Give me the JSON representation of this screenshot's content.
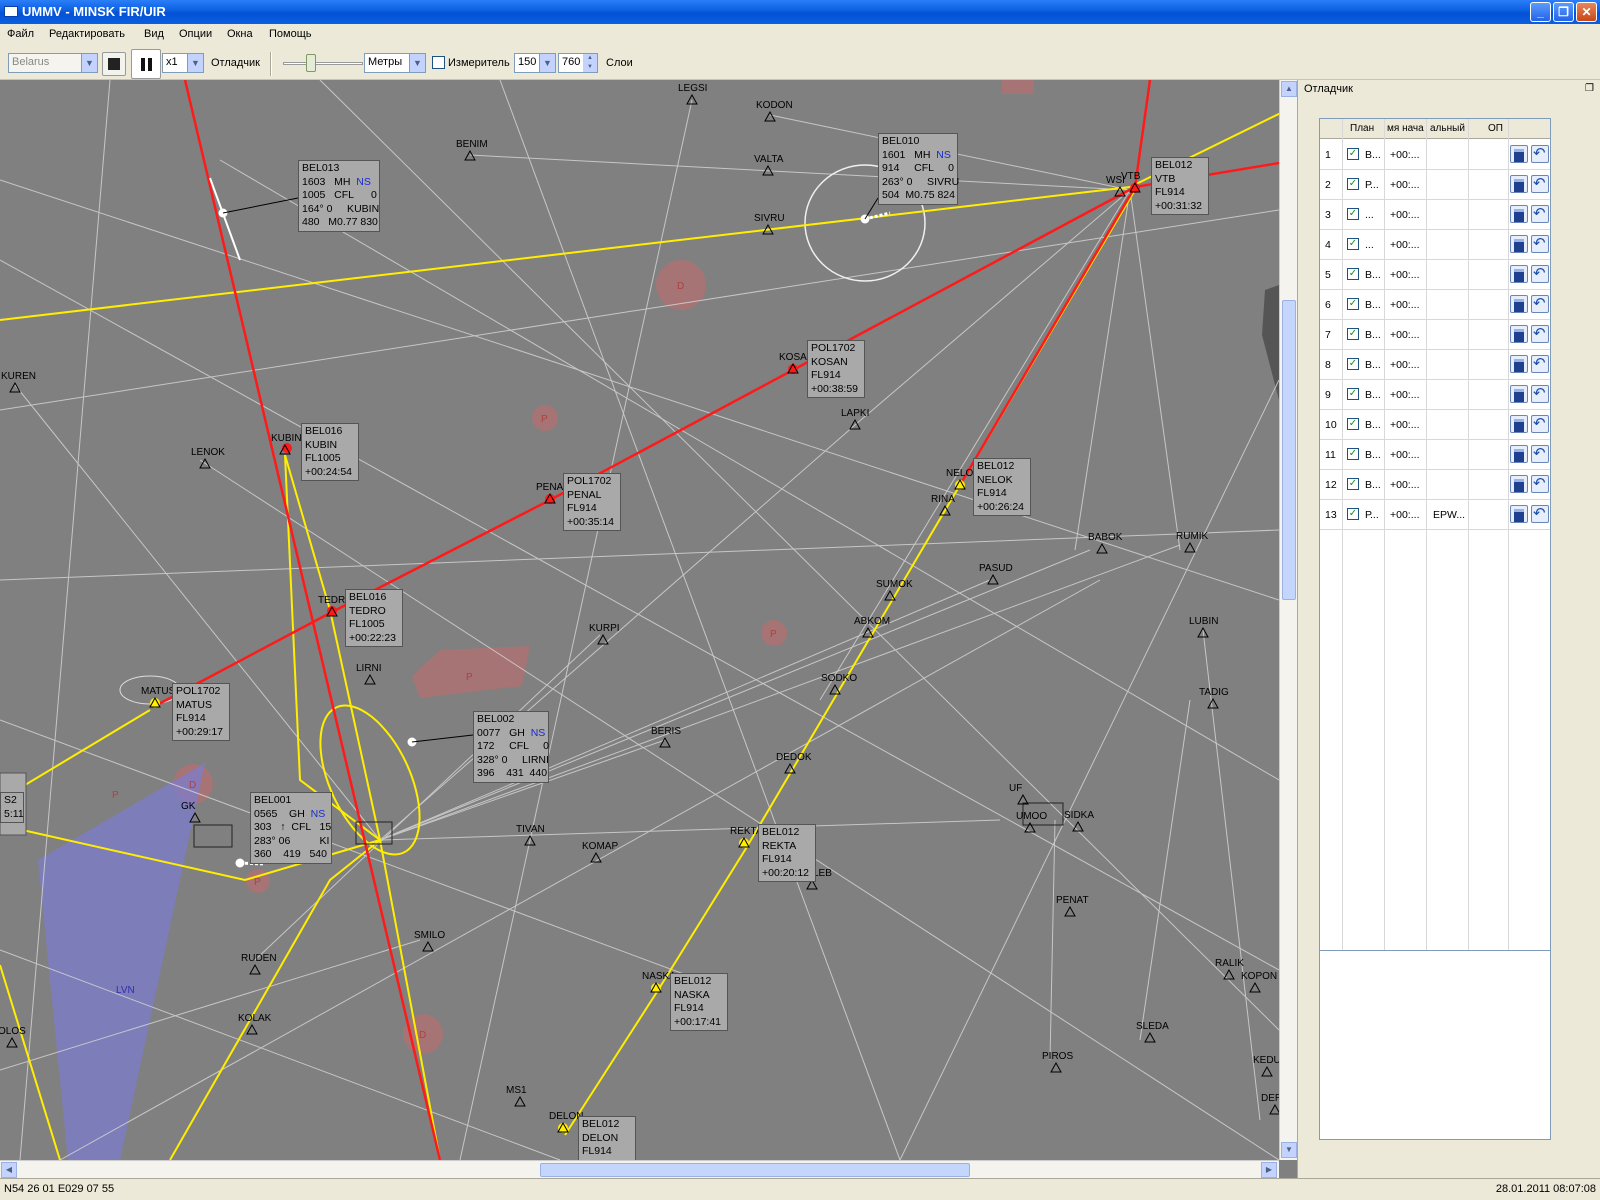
{
  "window": {
    "title": "UMMV - MINSK FIR/UIR",
    "minimize": "_",
    "maximize": "❐",
    "close": "✕"
  },
  "menu": [
    "Файл",
    "Редактировать",
    "Вид",
    "Опции",
    "Окна",
    "Помощь"
  ],
  "toolbar": {
    "region": "Belarus",
    "speed": "x1",
    "debugger_label": "Отладчик",
    "units": "Метры",
    "measure_label": "Измеритель",
    "measure_value": "150",
    "level_value": "760",
    "layers_label": "Слои"
  },
  "map": {
    "waypoints": [
      {
        "name": "LEGSI"
      },
      {
        "name": "KODON"
      },
      {
        "name": "BENIM"
      },
      {
        "name": "VALTA"
      },
      {
        "name": "SIVRU"
      },
      {
        "name": "KUREN"
      },
      {
        "name": "LENOK"
      },
      {
        "name": "KUBIN"
      },
      {
        "name": "KOSAN"
      },
      {
        "name": "LAPKI"
      },
      {
        "name": "PENAL"
      },
      {
        "name": "NELOK"
      },
      {
        "name": "RINA"
      },
      {
        "name": "BABOK"
      },
      {
        "name": "RUMIK"
      },
      {
        "name": "PASUD"
      },
      {
        "name": "SUMOK"
      },
      {
        "name": "ABKOM"
      },
      {
        "name": "KURPI"
      },
      {
        "name": "TEDRO"
      },
      {
        "name": "LIRNI"
      },
      {
        "name": "MATUS"
      },
      {
        "name": "LUBIN"
      },
      {
        "name": "TADIG"
      },
      {
        "name": "SODKO"
      },
      {
        "name": "BERIS"
      },
      {
        "name": "DEDOK"
      },
      {
        "name": "UF"
      },
      {
        "name": "UMOO"
      },
      {
        "name": "SIDKA"
      },
      {
        "name": "TIVAN"
      },
      {
        "name": "KOMAP"
      },
      {
        "name": "REKTA"
      },
      {
        "name": "DOLEB"
      },
      {
        "name": "PENAT"
      },
      {
        "name": "SMILO"
      },
      {
        "name": "RUDEN"
      },
      {
        "name": "NASKA"
      },
      {
        "name": "RALIK"
      },
      {
        "name": "KOPON"
      },
      {
        "name": "KOLAK"
      },
      {
        "name": "SLEDA"
      },
      {
        "name": "PIROS"
      },
      {
        "name": "KEDUG"
      },
      {
        "name": "DERAD"
      },
      {
        "name": "MS1"
      },
      {
        "name": "DELON"
      },
      {
        "name": "OLOS"
      },
      {
        "name": "GK"
      },
      {
        "name": "VTB"
      },
      {
        "name": "WSI"
      },
      {
        "name": "RAT"
      }
    ],
    "zone_labels": [
      "D",
      "P",
      "P",
      "D",
      "D",
      "P",
      "P",
      "P",
      "LVN"
    ],
    "datablocks": [
      {
        "id": "bel013",
        "lines": [
          "BEL013",
          "1603   MH",
          "1005   CFL      0",
          "164° 0     KUBIN",
          "480   M0.77 830"
        ],
        "badge": "NS"
      },
      {
        "id": "bel010",
        "lines": [
          "BEL010",
          "1601   MH",
          "914     CFL     0",
          "263° 0     SIVRU",
          "504  M0.75 824"
        ],
        "badge": "NS"
      },
      {
        "id": "bel012a",
        "lines": [
          "BEL012",
          "VTB",
          "FL914",
          "+00:31:32"
        ]
      },
      {
        "id": "pol1702a",
        "lines": [
          "POL1702",
          "KOSAN",
          "FL914",
          "+00:38:59"
        ]
      },
      {
        "id": "bel016a",
        "lines": [
          "BEL016",
          "KUBIN",
          "FL1005",
          "+00:24:54"
        ]
      },
      {
        "id": "pol1702b",
        "lines": [
          "POL1702",
          "PENAL",
          "FL914",
          "+00:35:14"
        ]
      },
      {
        "id": "bel012b",
        "lines": [
          "BEL012",
          "NELOK",
          "FL914",
          "+00:26:24"
        ]
      },
      {
        "id": "bel016b",
        "lines": [
          "BEL016",
          "TEDRO",
          "FL1005",
          "+00:22:23"
        ]
      },
      {
        "id": "pol1702c",
        "lines": [
          "POL1702",
          "MATUS",
          "FL914",
          "+00:29:17"
        ]
      },
      {
        "id": "bel002",
        "lines": [
          "BEL002",
          "0077   GH",
          "172     CFL     0",
          "328° 0     LIRNI",
          "396    431  440"
        ],
        "badge": "NS"
      },
      {
        "id": "bel001",
        "lines": [
          "BEL001",
          "0565    GH",
          "303   ↑  CFL   15",
          "283° 06          KI",
          "360    419   540"
        ],
        "badge": "NS"
      },
      {
        "id": "bel012c",
        "lines": [
          "BEL012",
          "REKTA",
          "FL914",
          "+00:20:12"
        ]
      },
      {
        "id": "bel012d",
        "lines": [
          "BEL012",
          "NASKA",
          "FL914",
          "+00:17:41"
        ]
      },
      {
        "id": "bel012e",
        "lines": [
          "BEL012",
          "DELON",
          "FL914"
        ]
      },
      {
        "id": "edge",
        "lines": [
          "S2",
          "",
          "5:11"
        ]
      }
    ]
  },
  "panel": {
    "title": "Отладчик",
    "columns": [
      "",
      "План",
      "мя нача",
      "альный",
      "ОП"
    ],
    "rows": [
      {
        "n": "1",
        "plan": "В...",
        "time": "+00:...",
        "extra": ""
      },
      {
        "n": "2",
        "plan": "Р...",
        "time": "+00:...",
        "extra": ""
      },
      {
        "n": "3",
        "plan": "...",
        "time": "+00:...",
        "extra": ""
      },
      {
        "n": "4",
        "plan": "...",
        "time": "+00:...",
        "extra": ""
      },
      {
        "n": "5",
        "plan": "В...",
        "time": "+00:...",
        "extra": ""
      },
      {
        "n": "6",
        "plan": "В...",
        "time": "+00:...",
        "extra": ""
      },
      {
        "n": "7",
        "plan": "В...",
        "time": "+00:...",
        "extra": ""
      },
      {
        "n": "8",
        "plan": "В...",
        "time": "+00:...",
        "extra": ""
      },
      {
        "n": "9",
        "plan": "В...",
        "time": "+00:...",
        "extra": ""
      },
      {
        "n": "10",
        "plan": "В...",
        "time": "+00:...",
        "extra": ""
      },
      {
        "n": "11",
        "plan": "В...",
        "time": "+00:...",
        "extra": ""
      },
      {
        "n": "12",
        "plan": "В...",
        "time": "+00:...",
        "extra": ""
      },
      {
        "n": "13",
        "plan": "Р...",
        "time": "+00:...",
        "extra": "EPW..."
      }
    ]
  },
  "status": {
    "coords": "N54 26 01 E029 07 55",
    "datetime": "28.01.2011 08:07:08"
  },
  "colors": {
    "route_red": "#ff1a1a",
    "route_yellow": "#ffee00",
    "map_bg": "#808080",
    "airspace": "#cc6666",
    "restricted_blue": "#7c7ccc"
  }
}
